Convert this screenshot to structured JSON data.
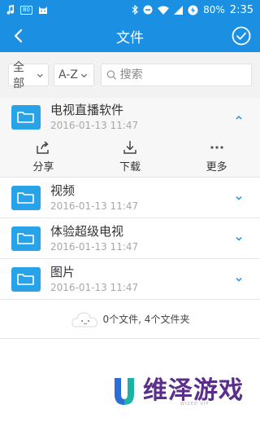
{
  "status_bar": {
    "battery": "80%",
    "time": "2:35",
    "icons": [
      "music-note-icon",
      "box-80-icon",
      "cat-icon",
      "bluetooth-icon",
      "do-not-disturb-icon",
      "wifi-icon",
      "signal-icon",
      "battery-saver-icon"
    ],
    "box_label": "80"
  },
  "app_bar": {
    "title": "文件",
    "back_icon": "back-arrow-icon",
    "confirm_icon": "check-circle-icon"
  },
  "filter": {
    "scope_value": "全部",
    "sort_value": "A-Z",
    "search_placeholder": "搜索"
  },
  "items": [
    {
      "name": "电视直播软件",
      "date": "2016-01-13 11:47",
      "expanded": true
    },
    {
      "name": "视频",
      "date": "2016-01-13 11:47",
      "expanded": false
    },
    {
      "name": "体验超级电视",
      "date": "2016-01-13 11:47",
      "expanded": false
    },
    {
      "name": "图片",
      "date": "2016-01-13 11:47",
      "expanded": false
    }
  ],
  "actions": [
    {
      "label": "分享",
      "icon": "share-icon"
    },
    {
      "label": "下载",
      "icon": "download-icon"
    },
    {
      "label": "更多",
      "icon": "more-icon"
    }
  ],
  "footer": {
    "summary": "0个文件, 4个文件夹"
  },
  "watermark": {
    "text": "维泽游戏",
    "sub": "WIZED VIP"
  },
  "colors": {
    "primary": "#1b8fe2",
    "folder": "#29a3e8",
    "watermark": "#5b2e8c"
  }
}
